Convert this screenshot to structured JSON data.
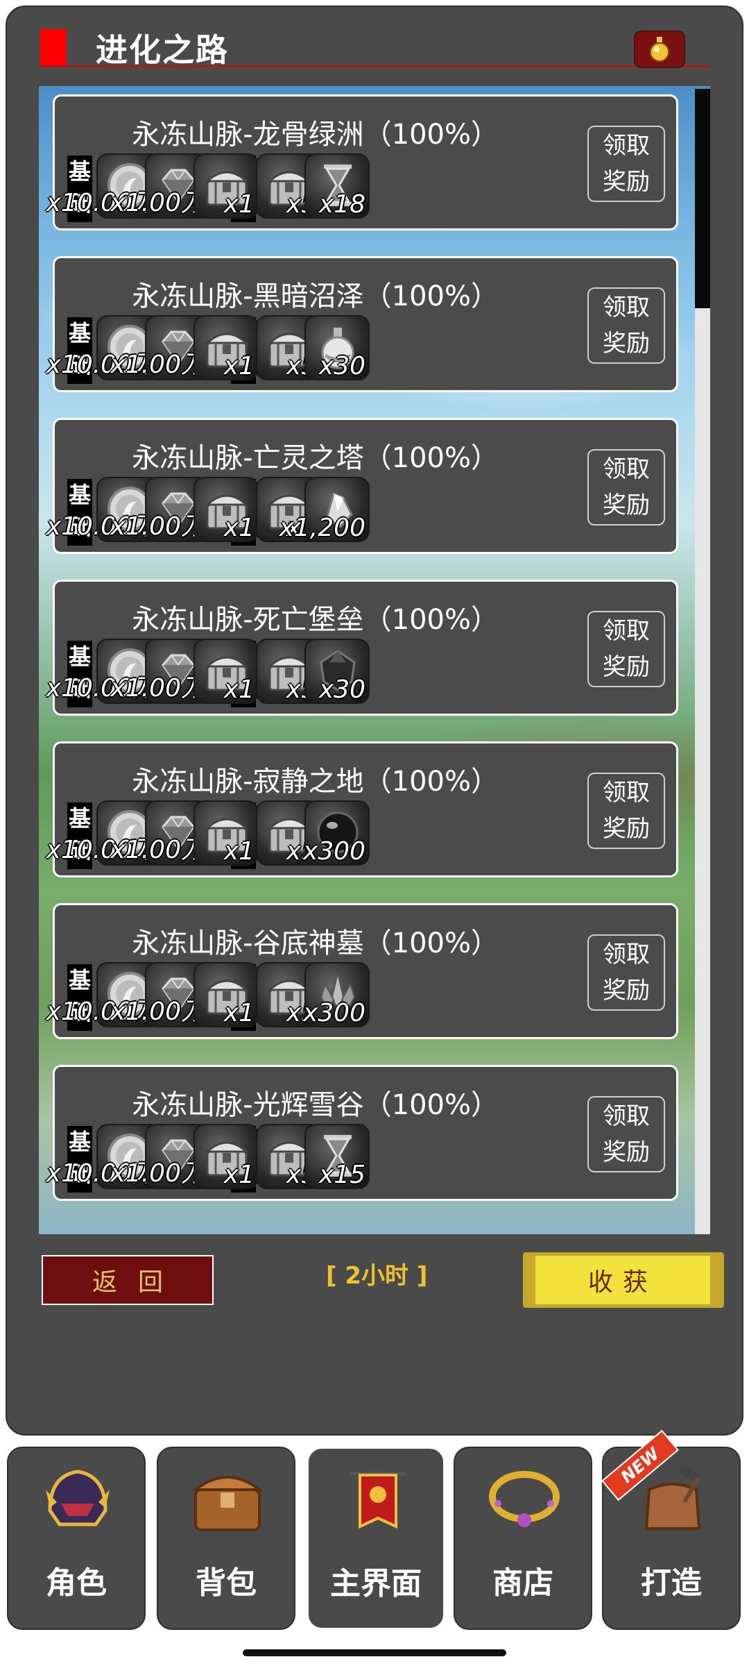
{
  "header": {
    "title": "进化之路"
  },
  "cards": [
    {
      "title": "永冻山脉-龙骨绿洲（100%）",
      "base_label_1": "基",
      "base_label_2": "础",
      "extra_label_1": "额",
      "extra_label_2": "外",
      "items": [
        {
          "icon": "silver-coin-icon",
          "qty": "x10.00万"
        },
        {
          "icon": "diamond-icon",
          "qty": "x1.00万"
        },
        {
          "icon": "treasure-chest-icon",
          "qty": "x1"
        },
        {
          "icon": "treasure-chest-icon",
          "qty": "x5"
        },
        {
          "icon": "hourglass-icon",
          "qty": "x18"
        }
      ],
      "claim_1": "领取",
      "claim_2": "奖励"
    },
    {
      "title": "永冻山脉-黑暗沼泽（100%）",
      "base_label_1": "基",
      "base_label_2": "础",
      "extra_label_1": "额",
      "extra_label_2": "外",
      "items": [
        {
          "icon": "silver-coin-icon",
          "qty": "x10.00万"
        },
        {
          "icon": "diamond-icon",
          "qty": "x1.00万"
        },
        {
          "icon": "treasure-chest-icon",
          "qty": "x1"
        },
        {
          "icon": "treasure-chest-icon",
          "qty": "x5"
        },
        {
          "icon": "potion-icon",
          "qty": "x30"
        }
      ],
      "claim_1": "领取",
      "claim_2": "奖励"
    },
    {
      "title": "永冻山脉-亡灵之塔（100%）",
      "base_label_1": "基",
      "base_label_2": "础",
      "extra_label_1": "额",
      "extra_label_2": "外",
      "items": [
        {
          "icon": "silver-coin-icon",
          "qty": "x10.00万"
        },
        {
          "icon": "diamond-icon",
          "qty": "x1.00万"
        },
        {
          "icon": "treasure-chest-icon",
          "qty": "x1"
        },
        {
          "icon": "treasure-chest-icon",
          "qty": "x5"
        },
        {
          "icon": "crystal-shard-icon",
          "qty": "x1,200"
        }
      ],
      "claim_1": "领取",
      "claim_2": "奖励"
    },
    {
      "title": "永冻山脉-死亡堡垒（100%）",
      "base_label_1": "基",
      "base_label_2": "础",
      "extra_label_1": "额",
      "extra_label_2": "外",
      "items": [
        {
          "icon": "silver-coin-icon",
          "qty": "x10.00万"
        },
        {
          "icon": "diamond-icon",
          "qty": "x1.00万"
        },
        {
          "icon": "treasure-chest-icon",
          "qty": "x1"
        },
        {
          "icon": "treasure-chest-icon",
          "qty": "x5"
        },
        {
          "icon": "dark-gem-icon",
          "qty": "x30"
        }
      ],
      "claim_1": "领取",
      "claim_2": "奖励"
    },
    {
      "title": "永冻山脉-寂静之地（100%）",
      "base_label_1": "基",
      "base_label_2": "础",
      "extra_label_1": "额",
      "extra_label_2": "外",
      "items": [
        {
          "icon": "silver-coin-icon",
          "qty": "x10.00万"
        },
        {
          "icon": "diamond-icon",
          "qty": "x1.00万"
        },
        {
          "icon": "treasure-chest-icon",
          "qty": "x1"
        },
        {
          "icon": "treasure-chest-icon",
          "qty": "x5"
        },
        {
          "icon": "black-orb-icon",
          "qty": "x300"
        }
      ],
      "claim_1": "领取",
      "claim_2": "奖励"
    },
    {
      "title": "永冻山脉-谷底神墓（100%）",
      "base_label_1": "基",
      "base_label_2": "础",
      "extra_label_1": "额",
      "extra_label_2": "外",
      "items": [
        {
          "icon": "silver-coin-icon",
          "qty": "x10.00万"
        },
        {
          "icon": "diamond-icon",
          "qty": "x1.00万"
        },
        {
          "icon": "treasure-chest-icon",
          "qty": "x1"
        },
        {
          "icon": "treasure-chest-icon",
          "qty": "x5"
        },
        {
          "icon": "crystal-cluster-icon",
          "qty": "x300"
        }
      ],
      "claim_1": "领取",
      "claim_2": "奖励"
    },
    {
      "title": "永冻山脉-光辉雪谷（100%）",
      "base_label_1": "基",
      "base_label_2": "础",
      "extra_label_1": "额",
      "extra_label_2": "外",
      "items": [
        {
          "icon": "silver-coin-icon",
          "qty": "x10.00万"
        },
        {
          "icon": "diamond-icon",
          "qty": "x1.00万"
        },
        {
          "icon": "treasure-chest-icon",
          "qty": "x1"
        },
        {
          "icon": "treasure-chest-icon",
          "qty": "x5"
        },
        {
          "icon": "hourglass-icon",
          "qty": "x15"
        }
      ],
      "claim_1": "领取",
      "claim_2": "奖励"
    }
  ],
  "footer": {
    "back_label": "返回",
    "timer_text": "[ 2小时 ]",
    "harvest_label": "收获"
  },
  "nav": [
    {
      "label": "角色",
      "icon": "helmet-icon"
    },
    {
      "label": "背包",
      "icon": "backpack-chest-icon"
    },
    {
      "label": "主界面",
      "icon": "banner-icon"
    },
    {
      "label": "商店",
      "icon": "necklace-icon"
    },
    {
      "label": "打造",
      "icon": "crafting-bag-icon",
      "badge": "NEW"
    }
  ],
  "colors": {
    "accent_red": "#ff0000",
    "harvest_yellow": "#f1e33b",
    "timer_gold": "#f1c22b",
    "panel_gray": "#4a4a4a"
  }
}
